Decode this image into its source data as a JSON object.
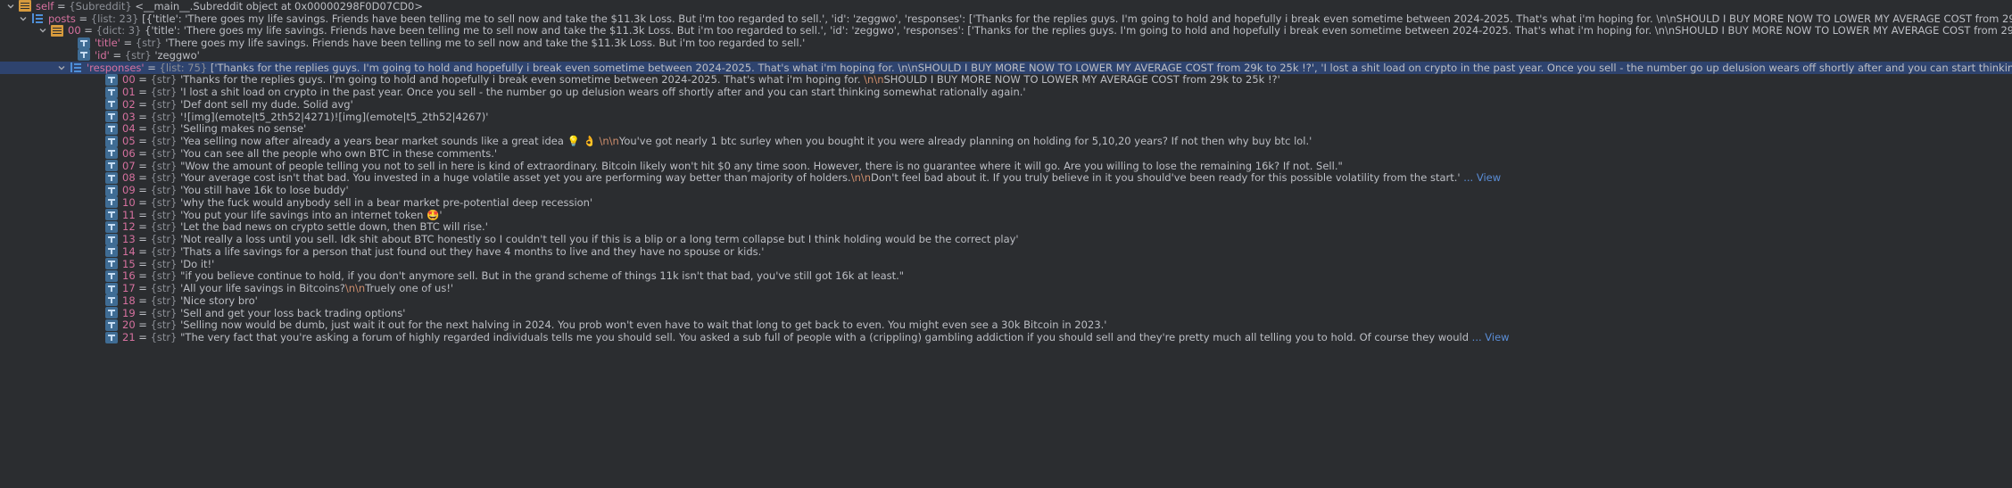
{
  "rows": [
    {
      "name": "self",
      "type": "{Subreddit}",
      "value": "<__main__.Subreddit object at 0x00000298F0D07CD0>",
      "icon": "object"
    },
    {
      "name": "posts",
      "type": "{list: 23}",
      "value": "[{'title': 'There goes my life savings. Friends have been telling me to sell now and take the $11.3k Loss. But i'm too regarded to sell.', 'id': 'zeggwo', 'responses': ['Thanks for the replies guys. I'm going to hold and hopefully i break even sometime between 2024-2025. That's what i'm hoping for. \\n\\nSHOULD I BUY MORE NOW TO LOWER MY AVERAGE COST from 29k to 25k !?', 'I lost a shit load on crypto in",
      "icon": "list"
    },
    {
      "name": "00",
      "type": "{dict: 3}",
      "value": "{'title': 'There goes my life savings. Friends have been telling me to sell now and take the $11.3k Loss. But i'm too regarded to sell.', 'id': 'zeggwo', 'responses': ['Thanks for the replies guys. I'm going to hold and hopefully i break even sometime between 2024-2025. That's what i'm hoping for. \\n\\nSHOULD I BUY MORE NOW TO LOWER MY AVERAGE COST from 29k to 25k !?', 'I lost a shit load on crypto i",
      "icon": "object"
    },
    {
      "name": "'title'",
      "type": "{str}",
      "value": "'There goes my life savings. Friends have been telling me to sell now and take the $11.3k Loss. But i'm too regarded to sell.'",
      "icon": "str"
    },
    {
      "name": "'id'",
      "type": "{str}",
      "value": "'zeggwo'",
      "icon": "str"
    },
    {
      "name": "'responses'",
      "type": "{list: 75}",
      "value": "['Thanks for the replies guys. I'm going to hold and hopefully i break even sometime between 2024-2025. That's what i'm hoping for. \\n\\nSHOULD I BUY MORE NOW TO LOWER MY AVERAGE COST from 29k to 25k !?', 'I lost a shit load on crypto in the past year. Once you sell - the number go up delusion wears off shortly after and you can start thinking somewhat rationally again.', 'Def do",
      "icon": "list"
    },
    {
      "name": "00",
      "type": "{str}",
      "segments": [
        {
          "t": "'Thanks for the replies guys. I'm going to hold and hopefully i break even sometime between 2024-2025. That's what i'm hoping for. "
        },
        {
          "t": "\\n\\n",
          "esc": true
        },
        {
          "t": "SHOULD I BUY MORE NOW TO LOWER MY AVERAGE COST from 29k to 25k !?'"
        }
      ],
      "icon": "str"
    },
    {
      "name": "01",
      "type": "{str}",
      "value": "'I lost a shit load on crypto in the past year. Once you sell - the number go up delusion wears off shortly after and you can start thinking somewhat rationally again.'",
      "icon": "str"
    },
    {
      "name": "02",
      "type": "{str}",
      "value": "'Def dont sell my dude. Solid avg'",
      "icon": "str"
    },
    {
      "name": "03",
      "type": "{str}",
      "value": "'![img](emote|t5_2th52|4271)![img](emote|t5_2th52|4267)'",
      "icon": "str"
    },
    {
      "name": "04",
      "type": "{str}",
      "value": "'Selling makes no sense'",
      "icon": "str"
    },
    {
      "name": "05",
      "type": "{str}",
      "segments": [
        {
          "t": "'Yea selling now after already a years bear market sounds like a great idea 💡 👌 "
        },
        {
          "t": "\\n\\n",
          "esc": true
        },
        {
          "t": "You've got nearly 1 btc surley when you bought it you were already planning on holding for 5,10,20 years? If not then why buy btc lol.'"
        }
      ],
      "icon": "str"
    },
    {
      "name": "06",
      "type": "{str}",
      "value": "'You can see all the people who own BTC in these comments.'",
      "icon": "str"
    },
    {
      "name": "07",
      "type": "{str}",
      "value": "\"Wow the amount of people telling you not to sell in here is kind of extraordinary. Bitcoin likely won't hit $0 any time soon. However, there is no guarantee where it will go. Are you willing to lose the remaining 16k? If not. Sell.\"",
      "icon": "str"
    },
    {
      "name": "08",
      "type": "{str}",
      "segments": [
        {
          "t": "'Your average cost isn't that bad. You invested in a huge volatile asset yet you are performing way better than majority of holders."
        },
        {
          "t": "\\n\\n",
          "esc": true
        },
        {
          "t": "Don't feel bad about it. If you truly believe in it you should've been ready for this possible volatility from the start.'"
        },
        {
          "t": " ... View",
          "link": true
        }
      ],
      "icon": "str"
    },
    {
      "name": "09",
      "type": "{str}",
      "value": "'You still have 16k to lose buddy'",
      "icon": "str"
    },
    {
      "name": "10",
      "type": "{str}",
      "value": "'why the fuck would anybody sell in a bear market pre-potential deep recession'",
      "icon": "str"
    },
    {
      "name": "11",
      "type": "{str}",
      "value": "'You put your life savings into an internet token 🤩'",
      "icon": "str"
    },
    {
      "name": "12",
      "type": "{str}",
      "value": "'Let the bad news on crypto settle down, then BTC will rise.'",
      "icon": "str"
    },
    {
      "name": "13",
      "type": "{str}",
      "value": "'Not really a loss until you sell. Idk shit about BTC honestly so I couldn't tell you if this is a blip or a long term collapse but I think holding would be the correct play'",
      "icon": "str"
    },
    {
      "name": "14",
      "type": "{str}",
      "value": "'Thats a life savings for a person that just found out they have 4 months to live and they have no spouse or kids.'",
      "icon": "str"
    },
    {
      "name": "15",
      "type": "{str}",
      "value": "'Do it!'",
      "icon": "str"
    },
    {
      "name": "16",
      "type": "{str}",
      "value": "\"if you believe continue to hold, if you don't anymore sell. But in the grand scheme of things 11k isn't that bad, you've still got 16k at least.\"",
      "icon": "str"
    },
    {
      "name": "17",
      "type": "{str}",
      "segments": [
        {
          "t": "'All your life savings in Bitcoins?"
        },
        {
          "t": "\\n\\n",
          "esc": true
        },
        {
          "t": "Truely one of us!'"
        }
      ],
      "icon": "str"
    },
    {
      "name": "18",
      "type": "{str}",
      "value": "'Nice story bro'",
      "icon": "str"
    },
    {
      "name": "19",
      "type": "{str}",
      "value": "'Sell and get your loss back trading options'",
      "icon": "str"
    },
    {
      "name": "20",
      "type": "{str}",
      "value": "'Selling now would be dumb, just wait it out for the next halving in 2024. You prob won't even have to wait that long to get back to even. You might even see a 30k Bitcoin in 2023.'",
      "icon": "str"
    },
    {
      "name": "21",
      "type": "{str}",
      "segments": [
        {
          "t": "\"The very fact that you're asking a forum of highly regarded individuals tells me you should sell. You asked a sub full of people with a (crippling) gambling addiction if you should sell and they're pretty much all telling you to hold. Of course they would"
        },
        {
          "t": " ... View",
          "link": true
        }
      ],
      "icon": "str"
    }
  ],
  "colors": {
    "background": "#2b2d30",
    "selected_row": "#2e436e",
    "name": "#d6719f",
    "type": "#8c8f96",
    "escape": "#cf8e6d",
    "link": "#5a8dd6"
  }
}
